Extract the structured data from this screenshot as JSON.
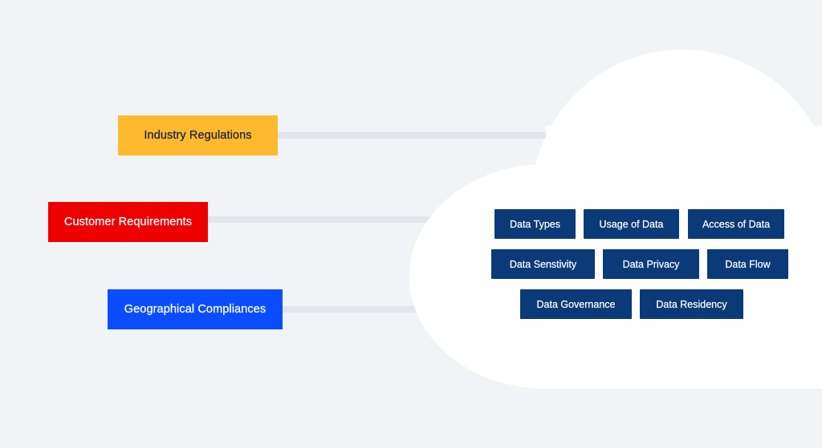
{
  "background_color": "#f1f4f7",
  "connector_color": "#e2e6ea",
  "cloud_color": "#ffffff",
  "categories": [
    {
      "label": "Industry Regulations",
      "color": "#fdba2e",
      "text_color": "#1c2340"
    },
    {
      "label": "Customer Requirements",
      "color": "#ee0000",
      "text_color": "#ffffff"
    },
    {
      "label": "Geographical Compliances",
      "color": "#0a4dff",
      "text_color": "#ffffff"
    }
  ],
  "cloud": {
    "chip_color": "#0b3a78",
    "chip_text_color": "#ffffff",
    "rows": [
      [
        "Data Types",
        "Usage of Data",
        "Access of Data"
      ],
      [
        "Data Senstivity",
        "Data Privacy",
        "Data Flow"
      ],
      [
        "Data Governance",
        "Data Residency"
      ]
    ]
  }
}
